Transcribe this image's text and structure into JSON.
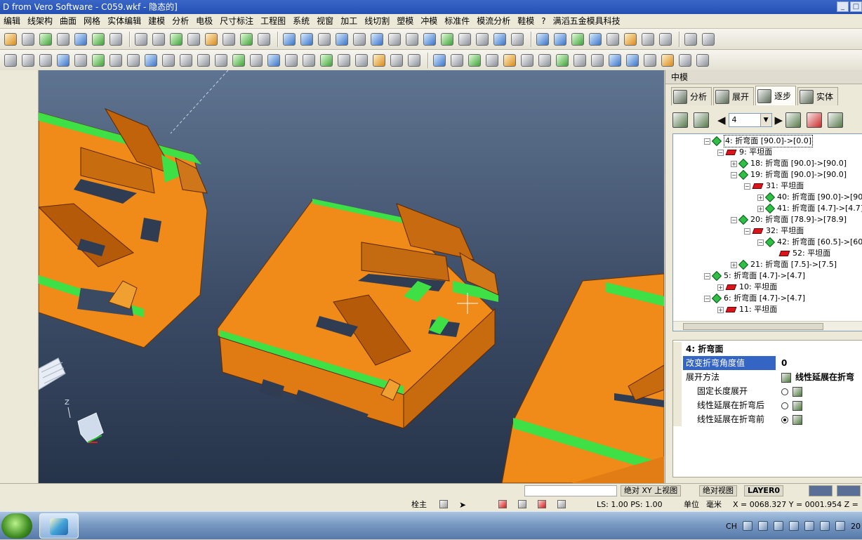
{
  "window": {
    "title": "D from Vero Software - C059.wkf - 隐态的]",
    "controls": [
      "_",
      "□",
      "×"
    ]
  },
  "menu": [
    "编辑",
    "线架构",
    "曲面",
    "网格",
    "实体编辑",
    "建模",
    "分析",
    "电极",
    "尺寸标注",
    "工程图",
    "系统",
    "视窗",
    "加工",
    "线切割",
    "塑模",
    "冲模",
    "标准件",
    "模流分析",
    "鞋模",
    "?",
    "满滔五金模具科技"
  ],
  "viewport": {
    "axis_label": "Z"
  },
  "panel": {
    "title": "中模",
    "tabs": [
      {
        "label": "分析",
        "icon": "analysis-icon"
      },
      {
        "label": "展开",
        "icon": "unfold-icon"
      },
      {
        "label": "逐步",
        "icon": "step-icon",
        "active": true
      },
      {
        "label": "实体",
        "icon": "solid-icon"
      }
    ],
    "step_value": "4",
    "tree": [
      {
        "level": 0,
        "icon": "bend",
        "label": "4: 折弯面 [90.0]->[0.0]",
        "selected": true,
        "expanded": true
      },
      {
        "level": 1,
        "icon": "flat",
        "label": "9: 平坦面",
        "expanded": true
      },
      {
        "level": 2,
        "icon": "bend",
        "label": "18: 折弯面 [90.0]->[90.0]",
        "expanded": false
      },
      {
        "level": 2,
        "icon": "bend",
        "label": "19: 折弯面 [90.0]->[90.0]",
        "expanded": true
      },
      {
        "level": 3,
        "icon": "flat",
        "label": "31: 平坦面",
        "expanded": true
      },
      {
        "level": 4,
        "icon": "bend",
        "label": "40: 折弯面 [90.0]->[90",
        "expanded": false
      },
      {
        "level": 4,
        "icon": "bend",
        "label": "41: 折弯面 [4.7]->[4.7]",
        "expanded": false
      },
      {
        "level": 2,
        "icon": "bend",
        "label": "20: 折弯面 [78.9]->[78.9]",
        "expanded": true
      },
      {
        "level": 3,
        "icon": "flat",
        "label": "32: 平坦面",
        "expanded": true
      },
      {
        "level": 4,
        "icon": "bend",
        "label": "42: 折弯面 [60.5]->[60",
        "expanded": true
      },
      {
        "level": 5,
        "icon": "flat",
        "label": "52: 平坦面",
        "expanded": null
      },
      {
        "level": 2,
        "icon": "bend",
        "label": "21: 折弯面 [7.5]->[7.5]",
        "expanded": false
      },
      {
        "level": 0,
        "icon": "bend",
        "label": "5: 折弯面 [4.7]->[4.7]",
        "expanded": true
      },
      {
        "level": 1,
        "icon": "flat",
        "label": "10: 平坦面",
        "expanded": false
      },
      {
        "level": 0,
        "icon": "bend",
        "label": "6: 折弯面 [4.7]->[4.7]",
        "expanded": true
      },
      {
        "level": 1,
        "icon": "flat",
        "label": "11: 平坦面",
        "expanded": false
      }
    ],
    "props": {
      "header": "4: 折弯面",
      "angle_label": "改变折弯角度值",
      "angle_value": "0",
      "method_label": "展开方法",
      "method_value": "线性延展在折弯",
      "options": [
        {
          "label": "固定长度展开",
          "checked": false
        },
        {
          "label": "线性延展在折弯后",
          "checked": false
        },
        {
          "label": "线性延展在折弯前",
          "checked": true
        }
      ]
    }
  },
  "status": {
    "view_buttons": [
      "绝对 XY 上视图",
      "绝对视图",
      "LAYER0"
    ],
    "snap_label": "栓主",
    "ls_ps": "LS: 1.00 PS: 1.00",
    "unit_label": "单位",
    "unit_value": "毫米",
    "coords": "X = 0068.327 Y = 0001.954 Z ="
  },
  "taskbar": {
    "lang": "CH",
    "clock": "20"
  }
}
